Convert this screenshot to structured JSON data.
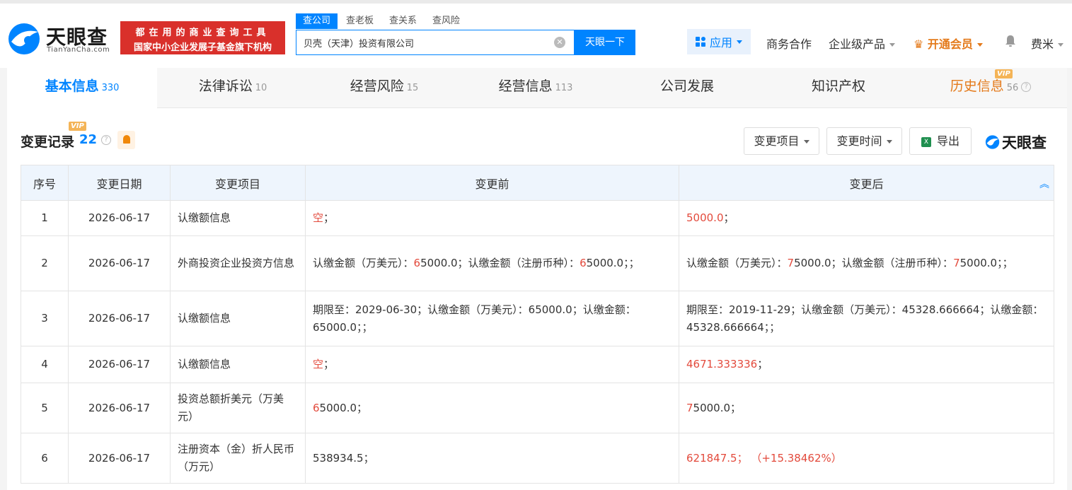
{
  "logo": {
    "name": "天眼查",
    "domain": "TianYanCha.com"
  },
  "slogan": {
    "line1": "都在用的商业查询工具",
    "line2": "国家中小企业发展子基金旗下机构"
  },
  "search": {
    "tabs": [
      "查公司",
      "查老板",
      "查关系",
      "查风险"
    ],
    "value": "贝壳（天津）投资有限公司",
    "button": "天眼一下"
  },
  "nav": {
    "apps": "应用",
    "business": "商务合作",
    "enterprise": "企业级产品",
    "vip": "开通会员",
    "user": "费米"
  },
  "tabs": [
    {
      "label": "基本信息",
      "count": "330"
    },
    {
      "label": "法律诉讼",
      "count": "10"
    },
    {
      "label": "经营风险",
      "count": "15"
    },
    {
      "label": "经营信息",
      "count": "113"
    },
    {
      "label": "公司发展",
      "count": ""
    },
    {
      "label": "知识产权",
      "count": ""
    },
    {
      "label": "历史信息",
      "count": "56"
    }
  ],
  "vip_badge": "VIP",
  "section": {
    "title": "变更记录",
    "count": "22",
    "filter_item": "变更项目",
    "filter_time": "变更时间",
    "export": "导出",
    "brand": "天眼查"
  },
  "table": {
    "headers": [
      "序号",
      "变更日期",
      "变更项目",
      "变更前",
      "变更后"
    ],
    "rows": [
      {
        "no": "1",
        "date": "2026-06-17",
        "item": "认缴额信息",
        "before": [
          [
            "空",
            true
          ],
          [
            "；",
            false
          ]
        ],
        "after": [
          [
            "5000.0",
            true
          ],
          [
            "；",
            false
          ]
        ]
      },
      {
        "no": "2",
        "date": "2026-06-17",
        "item": "外商投资企业投资方信息",
        "before": [
          [
            "认缴金额（万美元）：",
            false
          ],
          [
            "6",
            true
          ],
          [
            "5000.0；认缴金额（注册币种）：",
            false
          ],
          [
            "6",
            true
          ],
          [
            "5000.0；；",
            false
          ]
        ],
        "after": [
          [
            "认缴金额（万美元）：",
            false
          ],
          [
            "7",
            true
          ],
          [
            "5000.0；认缴金额（注册币种）：",
            false
          ],
          [
            "7",
            true
          ],
          [
            "5000.0；；",
            false
          ]
        ]
      },
      {
        "no": "3",
        "date": "2026-06-17",
        "item": "认缴额信息",
        "before": [
          [
            "期限至：2029-06-30；认缴金额（万美元）：65000.0；认缴金额：65000.0；；",
            false
          ]
        ],
        "after": [
          [
            "期限至：2019-11-29；认缴金额（万美元）：45328.666664；认缴金额：45328.666664；；",
            false
          ]
        ]
      },
      {
        "no": "4",
        "date": "2026-06-17",
        "item": "认缴额信息",
        "before": [
          [
            "空",
            true
          ],
          [
            "；",
            false
          ]
        ],
        "after": [
          [
            "4671.333336",
            true
          ],
          [
            "；",
            false
          ]
        ]
      },
      {
        "no": "5",
        "date": "2026-06-17",
        "item": "投资总额折美元（万美元）",
        "before": [
          [
            "6",
            true
          ],
          [
            "5000.0；",
            false
          ]
        ],
        "after": [
          [
            "7",
            true
          ],
          [
            "5000.0；",
            false
          ]
        ]
      },
      {
        "no": "6",
        "date": "2026-06-17",
        "item": "注册资本（金）折人民币（万元）",
        "before": [
          [
            "538934.5；",
            false
          ]
        ],
        "after": [
          [
            "621847.5；  （+15.38462%）",
            true
          ]
        ]
      }
    ]
  },
  "colors": {
    "accent": "#0084ff",
    "highlight": "#e34a3c",
    "vip": "#e47a1b",
    "slogan_bg": "#d9302b"
  }
}
